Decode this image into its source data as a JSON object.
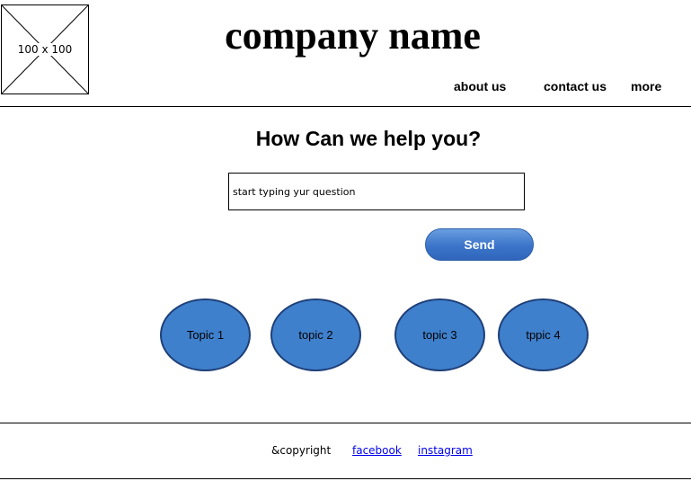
{
  "header": {
    "logo_placeholder": "100 x 100",
    "company_name": "company name",
    "nav": {
      "about": "about us",
      "contact": "contact us",
      "more": "more"
    }
  },
  "main": {
    "headline": "How Can we help you?",
    "question_placeholder": "start typing yur question",
    "send_label": "Send",
    "topics": [
      "Topic 1",
      "topic 2",
      "topic 3",
      "tppic 4"
    ]
  },
  "footer": {
    "copyright": "&copyright",
    "facebook": "facebook",
    "instagram": "instagram"
  },
  "colors": {
    "button_blue": "#3b74c9",
    "topic_fill": "#3f80cc",
    "topic_border": "#1e3f78",
    "link_blue": "#0000ee"
  }
}
